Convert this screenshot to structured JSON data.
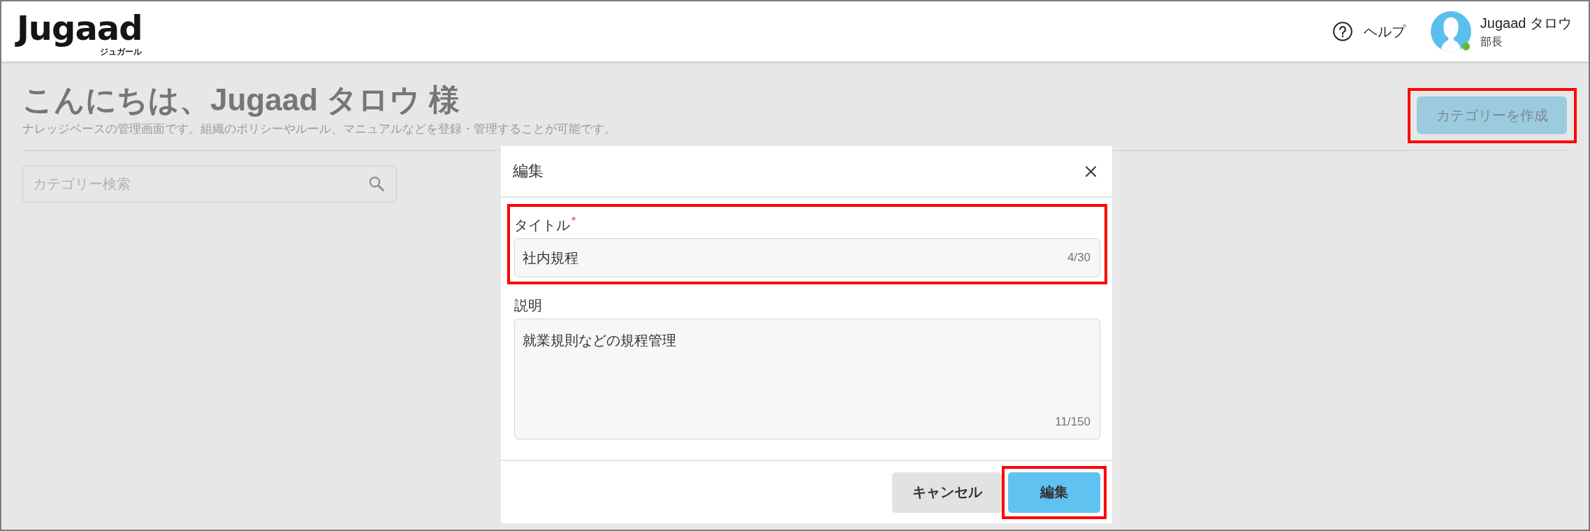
{
  "header": {
    "logo": {
      "wordmark": "Jugaad",
      "subtitle": "ジュガール"
    },
    "help": {
      "label": "ヘルプ"
    },
    "user": {
      "name": "Jugaad タロウ",
      "role": "部長",
      "online": true
    }
  },
  "page": {
    "title": "こんにちは、Jugaad タロウ 様",
    "description": "ナレッジベースの管理画面です。組織のポリシーやルール、マニュアルなどを登録・管理することが可能です。",
    "create_button": {
      "label": "カテゴリーを作成",
      "highlighted": true
    },
    "search": {
      "placeholder": "カテゴリー検索"
    }
  },
  "dialog": {
    "title": "編集",
    "fields": [
      {
        "kind": "input",
        "label": "タイトル",
        "required_mark": "*",
        "value": "社内規程",
        "counter": "4/30",
        "highlighted": true
      },
      {
        "kind": "textarea",
        "label": "説明",
        "value": "就業規則などの規程管理",
        "counter": "11/150",
        "highlighted": false
      }
    ],
    "buttons": [
      {
        "kind": "secondary",
        "label": "キャンセル",
        "highlighted": false
      },
      {
        "kind": "primary",
        "label": "編集",
        "highlighted": true
      }
    ]
  }
}
